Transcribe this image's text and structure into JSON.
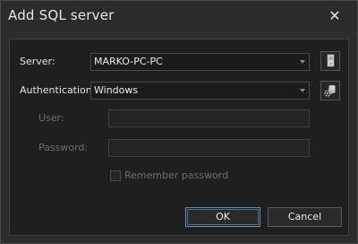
{
  "dialog": {
    "title": "Add SQL server",
    "close_glyph": "✕"
  },
  "form": {
    "server_label": "Server:",
    "server_value": "MARKO-PC-PC",
    "authentication_label": "Authentication:",
    "authentication_value": "Windows",
    "user_label": "User:",
    "user_value": "",
    "password_label": "Password:",
    "password_value": "",
    "remember_label": "Remember password",
    "remember_checked": false
  },
  "buttons": {
    "ok_label": "OK",
    "cancel_label": "Cancel"
  },
  "icons": {
    "close": "close-icon",
    "server_browse": "server-icon",
    "auth_settings": "database-gear-icon",
    "dropdown": "chevron-down-icon"
  },
  "colors": {
    "background": "#2d2d30",
    "panel": "#1f1f1f",
    "text": "#e4e4e4",
    "disabled_text": "#6e6e6e",
    "default_button_border": "#6a8fb8"
  }
}
